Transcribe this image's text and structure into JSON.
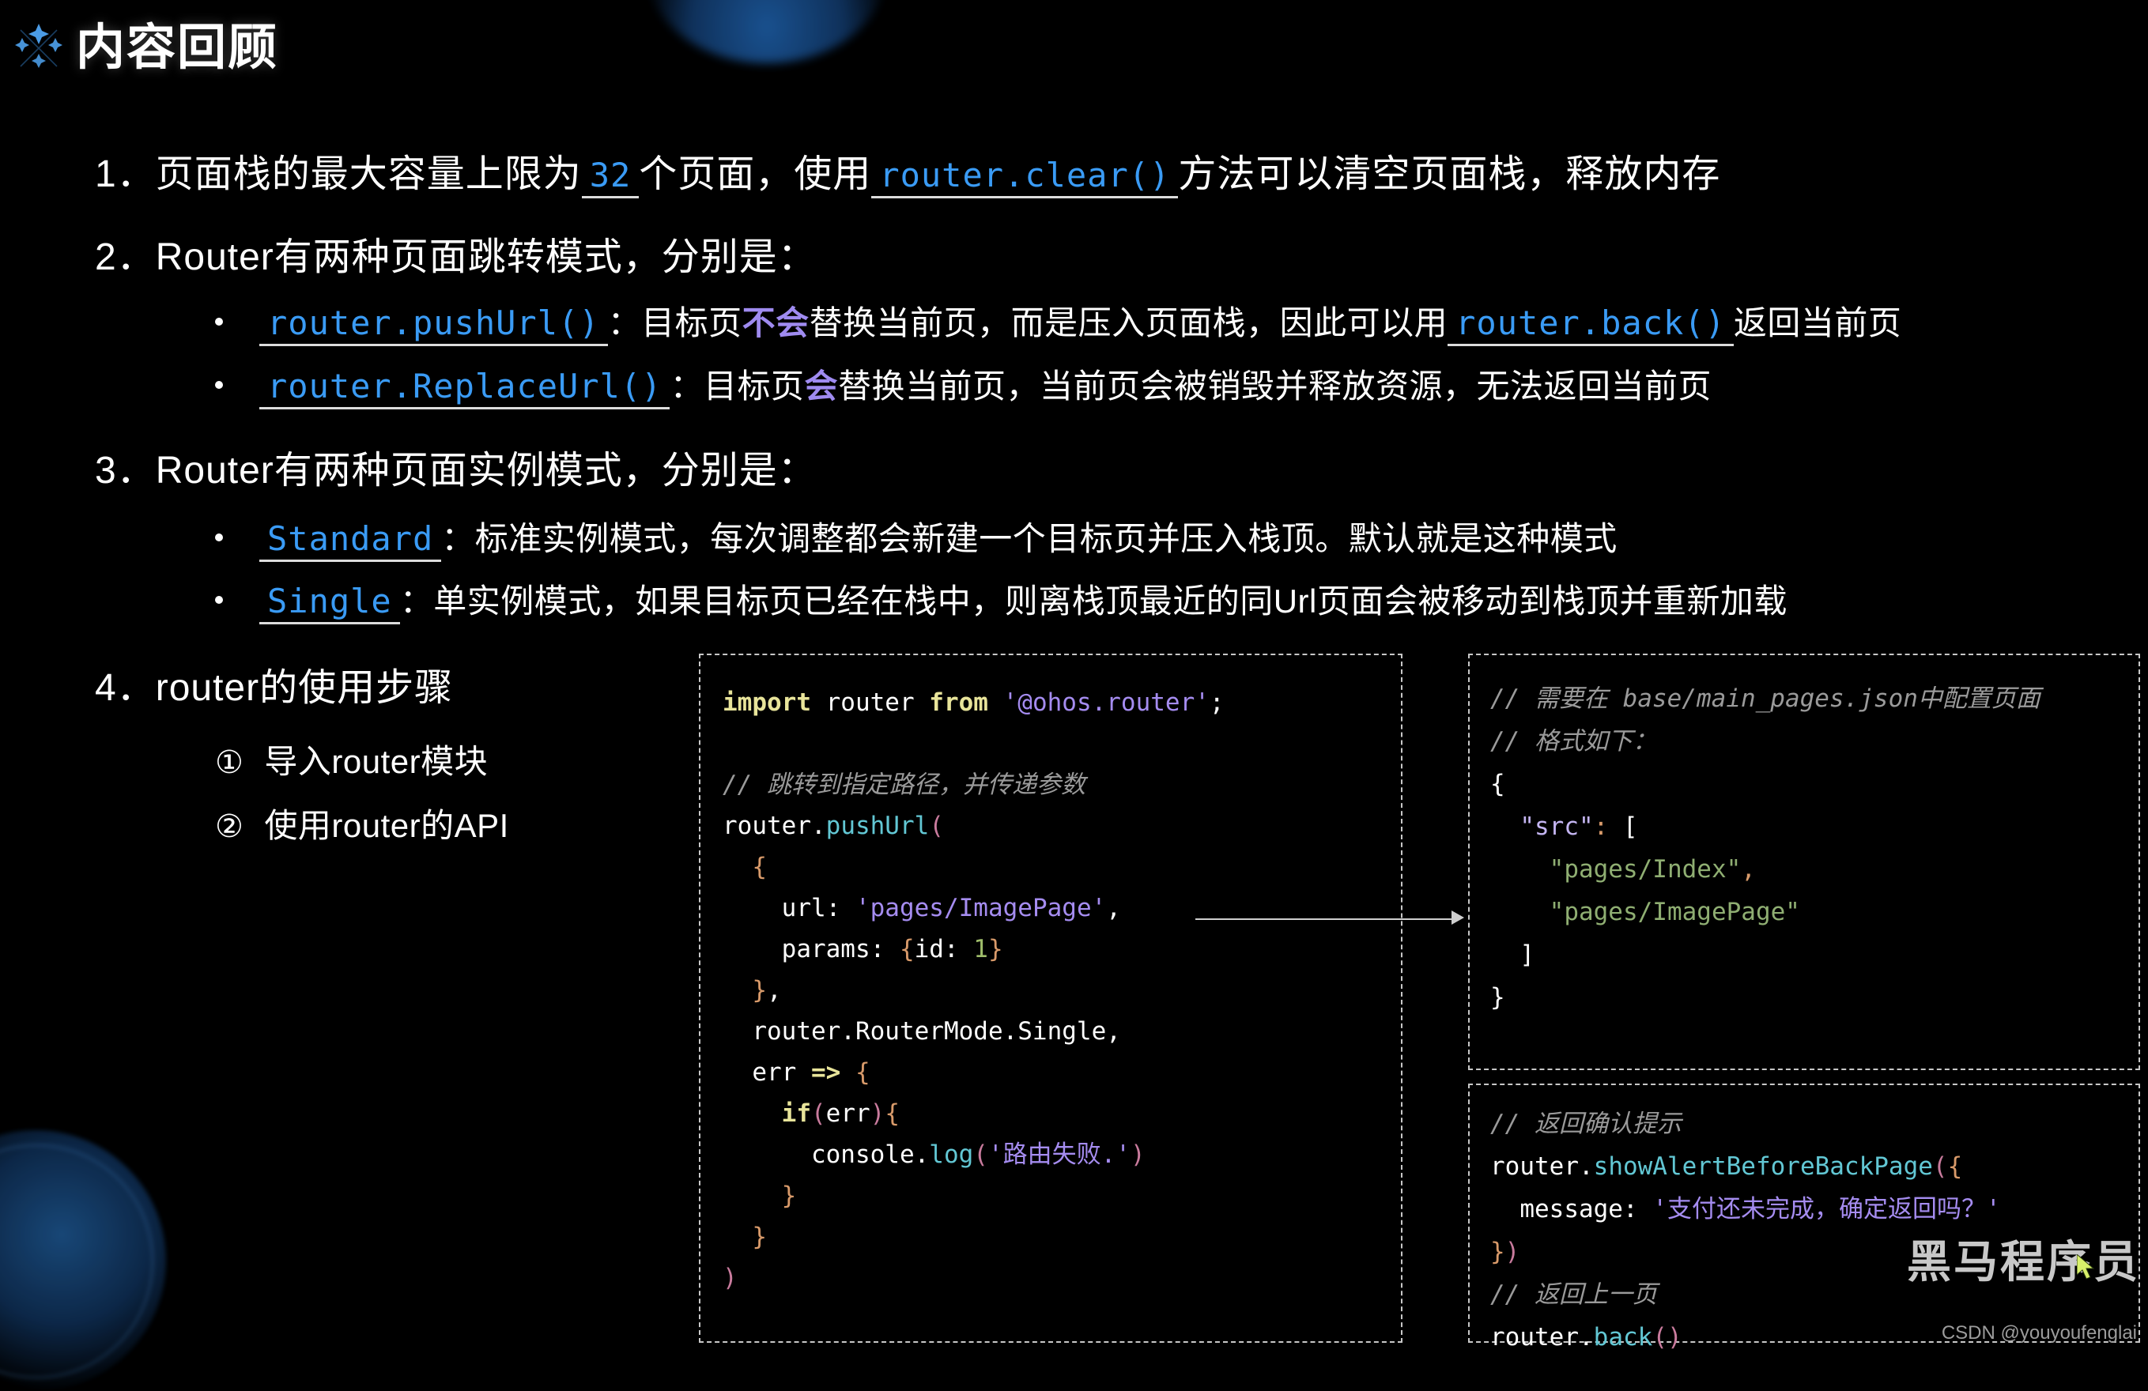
{
  "header": {
    "title": "内容回顾",
    "icon": "sparkle-icon"
  },
  "items": [
    {
      "number": "1．",
      "pre": "页面栈的最大容量上限为",
      "code1": "32",
      "mid": "个页面，使用",
      "code2": "router.clear()",
      "post": "方法可以清空页面栈，释放内存"
    },
    {
      "number": "2．",
      "text": "Router有两种页面跳转模式，分别是："
    },
    {
      "number": "3．",
      "text": "Router有两种页面实例模式，分别是："
    },
    {
      "number": "4．",
      "text": "router的使用步骤"
    }
  ],
  "bullets2": [
    {
      "code": "router.pushUrl()",
      "seg1": "：目标页",
      "emph": "不会",
      "seg2": "替换当前页，而是压入页面栈，因此可以用",
      "code2": "router.back()",
      "seg3": "返回当前页"
    },
    {
      "code": "router.ReplaceUrl()",
      "seg1": "：目标页",
      "emph": "会",
      "seg2": "替换当前页，当前页会被销毁并释放资源，无法返回当前页",
      "code2": "",
      "seg3": ""
    }
  ],
  "bullets3": [
    {
      "code": "Standard",
      "seg1": "：标准实例模式，每次调整都会新建一个目标页并压入栈顶。默认就是这种模式"
    },
    {
      "code": "Single",
      "seg1": "：单实例模式，如果目标页已经在栈中，则离栈顶最近的同Url页面会被移动到栈顶并重新加载"
    }
  ],
  "steps": [
    {
      "marker": "①",
      "text": "导入router模块"
    },
    {
      "marker": "②",
      "text": "使用router的API"
    }
  ],
  "code_main": {
    "lines": [
      [
        {
          "t": "import",
          "c": "kw"
        },
        {
          "t": " router ",
          "c": "pl"
        },
        {
          "t": "from",
          "c": "kw"
        },
        {
          "t": " ",
          "c": "pl"
        },
        {
          "t": "'@ohos.router'",
          "c": "str"
        },
        {
          "t": ";",
          "c": "pl"
        }
      ],
      [],
      [
        {
          "t": "// 跳转到指定路径，并传递参数",
          "c": "cm"
        }
      ],
      [
        {
          "t": "router.",
          "c": "pl"
        },
        {
          "t": "pushUrl",
          "c": "fn"
        },
        {
          "t": "(",
          "c": "pn2"
        }
      ],
      [
        {
          "t": "  {",
          "c": "pn"
        }
      ],
      [
        {
          "t": "    url: ",
          "c": "pl"
        },
        {
          "t": "'pages/ImagePage'",
          "c": "str"
        },
        {
          "t": ",",
          "c": "pl"
        }
      ],
      [
        {
          "t": "    params: ",
          "c": "pl"
        },
        {
          "t": "{",
          "c": "pn"
        },
        {
          "t": "id: ",
          "c": "pl"
        },
        {
          "t": "1",
          "c": "num"
        },
        {
          "t": "}",
          "c": "pn"
        }
      ],
      [
        {
          "t": "  }",
          "c": "pn"
        },
        {
          "t": ",",
          "c": "pl"
        }
      ],
      [
        {
          "t": "  router.RouterMode.Single,",
          "c": "pl"
        }
      ],
      [
        {
          "t": "  err ",
          "c": "pl"
        },
        {
          "t": "=>",
          "c": "kw"
        },
        {
          "t": " ",
          "c": "pl"
        },
        {
          "t": "{",
          "c": "pn"
        }
      ],
      [
        {
          "t": "    ",
          "c": "pl"
        },
        {
          "t": "if",
          "c": "kw"
        },
        {
          "t": "(",
          "c": "pn2"
        },
        {
          "t": "err",
          "c": "pl"
        },
        {
          "t": ")",
          "c": "pn2"
        },
        {
          "t": "{",
          "c": "pn"
        }
      ],
      [
        {
          "t": "      console.",
          "c": "pl"
        },
        {
          "t": "log",
          "c": "fn"
        },
        {
          "t": "(",
          "c": "pn2"
        },
        {
          "t": "'路由失败.'",
          "c": "str"
        },
        {
          "t": ")",
          "c": "pn2"
        }
      ],
      [
        {
          "t": "    }",
          "c": "pn"
        }
      ],
      [
        {
          "t": "  }",
          "c": "pn"
        }
      ],
      [
        {
          "t": ")",
          "c": "pn2"
        }
      ]
    ]
  },
  "code_json": {
    "lines": [
      [
        {
          "t": "// 需要在 base/main_pages.json中配置页面",
          "c": "cm"
        }
      ],
      [
        {
          "t": "// 格式如下：",
          "c": "cm"
        }
      ],
      [
        {
          "t": "{",
          "c": "pl"
        }
      ],
      [
        {
          "t": "  ",
          "c": "pl"
        },
        {
          "t": "\"src\"",
          "c": "prop"
        },
        {
          "t": ":",
          "c": "pn"
        },
        {
          "t": " [",
          "c": "pl"
        }
      ],
      [
        {
          "t": "    ",
          "c": "pl"
        },
        {
          "t": "\"pages/Index\"",
          "c": "strg"
        },
        {
          "t": ",",
          "c": "pn"
        }
      ],
      [
        {
          "t": "    ",
          "c": "pl"
        },
        {
          "t": "\"pages/ImagePage\"",
          "c": "strg"
        }
      ],
      [
        {
          "t": "  ]",
          "c": "pl"
        }
      ],
      [
        {
          "t": "}",
          "c": "pl"
        }
      ]
    ]
  },
  "code_alert": {
    "lines": [
      [
        {
          "t": "// 返回确认提示",
          "c": "cm"
        }
      ],
      [
        {
          "t": "router.",
          "c": "pl"
        },
        {
          "t": "showAlertBeforeBackPage",
          "c": "fn"
        },
        {
          "t": "(",
          "c": "pn2"
        },
        {
          "t": "{",
          "c": "pn"
        }
      ],
      [
        {
          "t": "  message: ",
          "c": "pl"
        },
        {
          "t": "'支付还未完成，确定返回吗？'",
          "c": "str"
        }
      ],
      [
        {
          "t": "}",
          "c": "pn"
        },
        {
          "t": ")",
          "c": "pn2"
        }
      ],
      [
        {
          "t": "// 返回上一页",
          "c": "cm"
        }
      ],
      [
        {
          "t": "router.",
          "c": "pl"
        },
        {
          "t": "back",
          "c": "fn"
        },
        {
          "t": "(",
          "c": "pn2"
        },
        {
          "t": ")",
          "c": "pn2"
        }
      ]
    ]
  },
  "watermark": {
    "brand": "黑马程序员",
    "credit": "CSDN @youyoufenglai"
  },
  "colors": {
    "background": "#000000",
    "text": "#ffffff",
    "code_link": "#3a9bf5",
    "emphasis": "#9f8bf0",
    "box_border": "#c8c8c8"
  }
}
